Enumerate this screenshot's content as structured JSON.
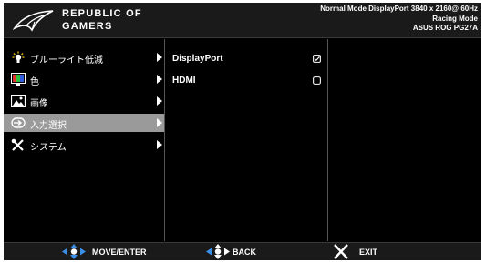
{
  "brand": {
    "line1": "REPUBLIC OF",
    "line2": "GAMERS"
  },
  "status": {
    "line1": "Normal Mode DisplayPort 3840 x 2160@ 60Hz",
    "line2": "Racing Mode",
    "line3": "ASUS ROG PG27A"
  },
  "menu": {
    "items": [
      {
        "label": "ブルーライト低減",
        "icon": "bulb-icon"
      },
      {
        "label": "色",
        "icon": "color-icon"
      },
      {
        "label": "画像",
        "icon": "image-icon"
      },
      {
        "label": "入力選択",
        "icon": "input-icon",
        "selected": true
      },
      {
        "label": "システム",
        "icon": "tools-icon"
      }
    ]
  },
  "options": {
    "items": [
      {
        "label": "DisplayPort",
        "state": "checked"
      },
      {
        "label": "HDMI",
        "state": "unchecked"
      }
    ]
  },
  "footer": {
    "move_enter": "MOVE/ENTER",
    "back": "BACK",
    "exit": "EXIT"
  },
  "colors": {
    "selected_bg": "#9a9a9a",
    "panel_bg": "#000000",
    "accent": "#3b8fe6"
  }
}
